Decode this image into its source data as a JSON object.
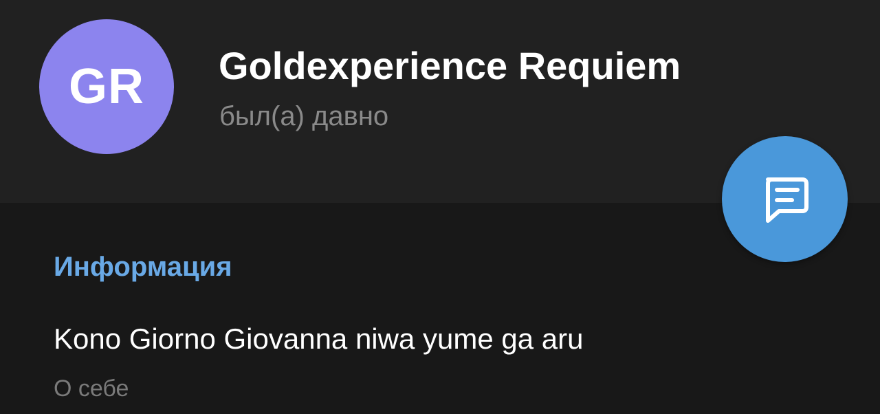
{
  "profile": {
    "avatar_initials": "GR",
    "avatar_color": "#8c84ee",
    "name": "Goldexperience Requiem",
    "status": "был(а) давно"
  },
  "message_button": {
    "icon": "message-icon",
    "color": "#4a98da"
  },
  "info": {
    "section_title": "Информация",
    "bio_value": "Kono Giorno Giovanna niwa yume ga aru",
    "bio_label": "О себе"
  },
  "colors": {
    "header_bg": "#212121",
    "page_bg": "#181818",
    "accent": "#69a9e6"
  }
}
